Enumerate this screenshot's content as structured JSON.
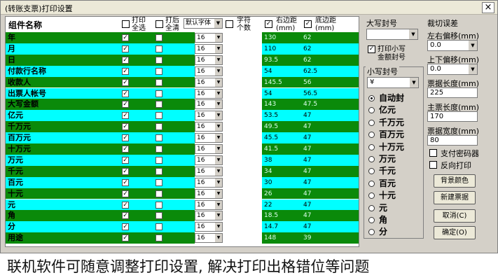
{
  "window": {
    "title": "(转账支票)打印设置",
    "close": "×"
  },
  "grid": {
    "header": {
      "name": "组件名称",
      "print_all": "打印全选",
      "clear_all": "打后全清",
      "font": "默认字体",
      "char_count": "字符个数",
      "right_margin": "右边距(mm)",
      "bottom_margin": "底边距(mm)"
    },
    "rows": [
      {
        "name": "年",
        "size": "16",
        "right": "130",
        "bottom": "62",
        "checked": true
      },
      {
        "name": "月",
        "size": "16",
        "right": "110",
        "bottom": "62",
        "checked": true
      },
      {
        "name": "日",
        "size": "16",
        "right": "93.5",
        "bottom": "62",
        "checked": true
      },
      {
        "name": "付款行名称",
        "size": "16",
        "right": "54",
        "bottom": "62.5",
        "checked": true
      },
      {
        "name": "收款人",
        "size": "16",
        "right": "145.5",
        "bottom": "56",
        "checked": true
      },
      {
        "name": "出票人帐号",
        "size": "16",
        "right": "54",
        "bottom": "56.5",
        "checked": true
      },
      {
        "name": "大写金额",
        "size": "16",
        "right": "143",
        "bottom": "47.5",
        "checked": true
      },
      {
        "name": "亿元",
        "size": "16",
        "right": "53.5",
        "bottom": "47",
        "checked": true
      },
      {
        "name": "千万元",
        "size": "16",
        "right": "49.5",
        "bottom": "47",
        "checked": true
      },
      {
        "name": "百万元",
        "size": "16",
        "right": "45.5",
        "bottom": "47",
        "checked": true
      },
      {
        "name": "十万元",
        "size": "16",
        "right": "41.5",
        "bottom": "47",
        "checked": true
      },
      {
        "name": "万元",
        "size": "16",
        "right": "38",
        "bottom": "47",
        "checked": true
      },
      {
        "name": "千元",
        "size": "16",
        "right": "34",
        "bottom": "47",
        "checked": true
      },
      {
        "name": "百元",
        "size": "16",
        "right": "30",
        "bottom": "47",
        "checked": true
      },
      {
        "name": "十元",
        "size": "16",
        "right": "26",
        "bottom": "47",
        "checked": true
      },
      {
        "name": "元",
        "size": "16",
        "right": "22",
        "bottom": "47",
        "checked": true
      },
      {
        "name": "角",
        "size": "16",
        "right": "18.5",
        "bottom": "47",
        "checked": true
      },
      {
        "name": "分",
        "size": "16",
        "right": "14.7",
        "bottom": "47",
        "checked": true
      },
      {
        "name": "用途",
        "size": "16",
        "right": "148",
        "bottom": "39",
        "checked": true
      }
    ]
  },
  "middle": {
    "capital_seal_label": "大写封号",
    "capital_seal_value": "",
    "print_small_label_1": "打印小写",
    "print_small_label_2": "金额封号",
    "small_seal_label": "小写封号",
    "small_seal_value": "¥",
    "radios": [
      "自动封",
      "亿元",
      "千万元",
      "百万元",
      "十万元",
      "万元",
      "千元",
      "百元",
      "十元",
      "元",
      "角",
      "分"
    ]
  },
  "right": {
    "cut_error": "裁切误差",
    "lr_offset_label": "左右偏移(mm)",
    "lr_offset": "0.0",
    "ud_offset_label": "上下偏移(mm)",
    "ud_offset": "0.0",
    "ticket_len_label": "票据长度(mm)",
    "ticket_len": "225",
    "main_len_label": "主票长度(mm)",
    "main_len": "170",
    "ticket_width_label": "票据宽度(mm)",
    "ticket_width": "80",
    "pay_pwd": "支付密码器",
    "reverse_print": "反向打印",
    "bg_color": "背景颜色",
    "new_ticket": "新建票据",
    "cancel": "取消(C)",
    "ok": "确定(O)"
  },
  "caption": "联机软件可随意调整打印设置, 解决打印出格错位等问题",
  "colors": {
    "green": "#0a8a0a",
    "cyan": "#00ffff"
  }
}
